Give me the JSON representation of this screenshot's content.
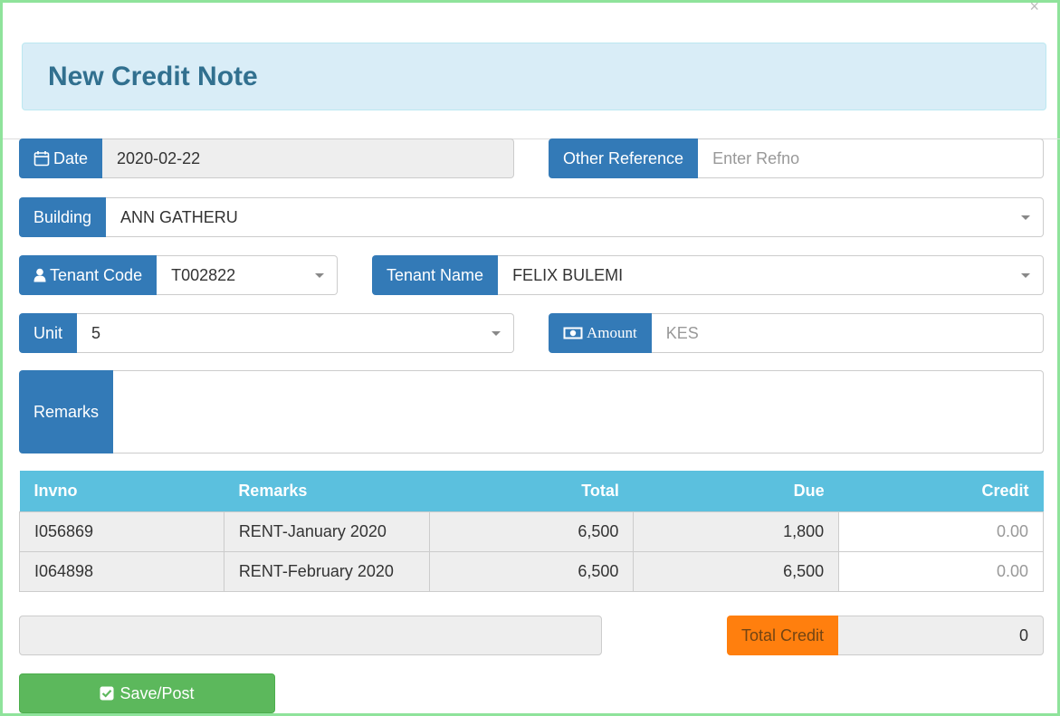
{
  "title": "New Credit Note",
  "close": "×",
  "date": {
    "label": "Date",
    "value": "2020-02-22"
  },
  "other_reference": {
    "label": "Other Reference",
    "placeholder": "Enter Refno"
  },
  "building": {
    "label": "Building",
    "value": "ANN GATHERU"
  },
  "tenant_code": {
    "label": "Tenant Code",
    "value": "T002822"
  },
  "tenant_name": {
    "label": "Tenant Name",
    "value": "FELIX BULEMI"
  },
  "unit": {
    "label": "Unit",
    "value": "5"
  },
  "amount": {
    "label": "Amount",
    "placeholder": "KES"
  },
  "remarks": {
    "label": "Remarks"
  },
  "table": {
    "headers": [
      "Invno",
      "Remarks",
      "Total",
      "Due",
      "Credit"
    ],
    "rows": [
      {
        "invno": "I056869",
        "remarks": "RENT-January 2020",
        "total": "6,500",
        "due": "1,800",
        "credit": "0.00"
      },
      {
        "invno": "I064898",
        "remarks": "RENT-February 2020",
        "total": "6,500",
        "due": "6,500",
        "credit": "0.00"
      }
    ]
  },
  "total_credit": {
    "label": "Total Credit",
    "value": "0"
  },
  "save_label": "Save/Post",
  "colors": {
    "primary": "#337ab7",
    "info": "#5bc0de",
    "success": "#5cb85c",
    "warning": "#ff7f0e",
    "title_bg": "#d9edf7",
    "title_text": "#31708f"
  }
}
